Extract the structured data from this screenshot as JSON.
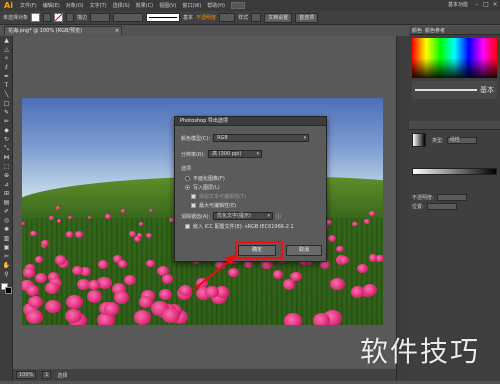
{
  "app": {
    "logo": "Ai",
    "workspace": "基本功能"
  },
  "menu": [
    "文件(F)",
    "编辑(E)",
    "对象(O)",
    "文字(T)",
    "选择(S)",
    "效果(C)",
    "视图(V)",
    "窗口(W)",
    "帮助(H)"
  ],
  "control_bar": {
    "selection_label": "未选择对象",
    "stroke_label": "描边",
    "style_label": "样式",
    "opacity_label": "不透明度",
    "doc_setup": "文档设置",
    "preferences": "首选项",
    "stroke_weight": "基本"
  },
  "document_tab": {
    "title": "花海.png* @ 100% (RGB/预览)",
    "close": "×"
  },
  "status": {
    "zoom": "100%",
    "page": "1",
    "mode": "选择"
  },
  "panels": {
    "color_title": "颜色",
    "color_ref_title": "颜色参考",
    "stroke_style": "基本",
    "gradient_type": "类型:",
    "gradient_type_value": "线性",
    "opacity_label": "不透明度:",
    "position_label": "位置:"
  },
  "dialog": {
    "title": "Photoshop 导出选项",
    "color_model_label": "颜色模型(C):",
    "color_model_value": "RGB",
    "resolution_label": "分辨率(R):",
    "resolution_value": "高 (300 ppi)",
    "options_heading": "选项",
    "flat_image": "平面化图像(F)",
    "write_layers": "写入图层(L)",
    "preserve_text": "保留文本可编辑性(T)",
    "max_editability": "最大可编辑性(E)",
    "antialias_label": "消除锯齿(A):",
    "antialias_value": "优化文字(提示)",
    "embed_icc": "嵌入 ICC 配置文件(E): sRGB IEC61966-2.1",
    "ok": "确定",
    "cancel": "取消"
  },
  "watermark": "软件技巧",
  "colors": {
    "highlight": "#e11111",
    "logo": "#ff9a00"
  },
  "icons": [
    "selection-tool-icon",
    "direct-select-icon",
    "magic-wand-icon",
    "lasso-icon",
    "pen-icon",
    "type-icon",
    "line-icon",
    "rectangle-icon",
    "brush-icon",
    "pencil-icon",
    "eraser-icon",
    "rotate-icon",
    "scale-icon",
    "width-icon",
    "free-transform-icon",
    "shape-builder-icon",
    "perspective-icon",
    "mesh-icon",
    "gradient-icon",
    "eyedropper-icon",
    "blend-icon",
    "symbol-sprayer-icon",
    "graph-icon",
    "artboard-icon",
    "slice-icon",
    "hand-icon",
    "zoom-icon"
  ]
}
